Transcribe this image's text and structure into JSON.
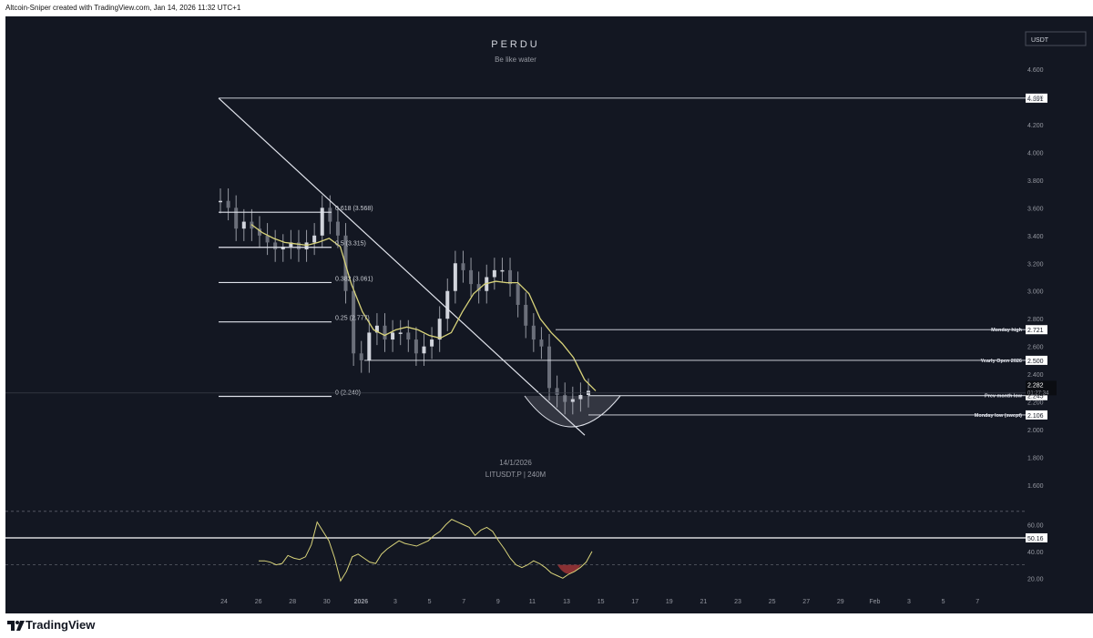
{
  "header": {
    "attribution": "Altcoin-Sniper created with TradingView.com, Jan 14, 2026 11:32 UTC+1"
  },
  "footer": {
    "brand": "TradingView"
  },
  "chart_data": {
    "type": "line",
    "title": "PERDU",
    "subtitle": "Be like water",
    "annotation_date": "14/1/2026",
    "symbol_label": "LITUSDT.P | 240M",
    "currency": "USDT",
    "price_axis": {
      "ticks": [
        "4.600",
        "4.400",
        "4.200",
        "4.000",
        "3.800",
        "3.600",
        "3.400",
        "3.200",
        "3.000",
        "2.800",
        "2.600",
        "2.400",
        "2.200",
        "2.000",
        "1.800",
        "1.600"
      ],
      "ylim": [
        1.6,
        4.6
      ]
    },
    "x_ticks": [
      "24",
      "26",
      "28",
      "30",
      "2026",
      "3",
      "5",
      "7",
      "9",
      "11",
      "13",
      "15",
      "17",
      "19",
      "21",
      "23",
      "25",
      "27",
      "29",
      "Feb",
      "3",
      "5",
      "7"
    ],
    "candles": [
      3.65,
      3.6,
      3.45,
      3.5,
      3.45,
      3.4,
      3.35,
      3.3,
      3.32,
      3.35,
      3.3,
      3.35,
      3.4,
      3.6,
      3.5,
      3.4,
      3.0,
      2.55,
      2.5,
      2.7,
      2.75,
      2.65,
      2.7,
      2.7,
      2.65,
      2.55,
      2.6,
      2.65,
      2.8,
      3.0,
      3.2,
      3.15,
      3.05,
      3.0,
      3.1,
      3.15,
      3.15,
      3.05,
      2.9,
      2.75,
      2.65,
      2.6,
      2.3,
      2.25,
      2.2,
      2.22,
      2.25,
      2.28
    ],
    "ma_series": {
      "name": "",
      "color": "#d8d37a",
      "values": [
        3.48,
        3.42,
        3.38,
        3.35,
        3.34,
        3.33,
        3.35,
        3.38,
        3.32,
        3.05,
        2.85,
        2.72,
        2.68,
        2.72,
        2.74,
        2.72,
        2.68,
        2.66,
        2.7,
        2.85,
        2.98,
        3.05,
        3.07,
        3.06,
        3.06,
        2.98,
        2.8,
        2.7,
        2.62,
        2.52,
        2.36,
        2.28
      ]
    },
    "fib_levels": [
      {
        "label": "0.618 (3.568)",
        "price": 3.568
      },
      {
        "label": "0.5 (3.315)",
        "price": 3.315
      },
      {
        "label": "0.382 (3.061)",
        "price": 3.061
      },
      {
        "label": "0.25 (2.777)",
        "price": 2.777
      },
      {
        "label": "0 (2.240)",
        "price": 2.24
      }
    ],
    "levels": [
      {
        "label": "",
        "price": 4.391,
        "tag": "4.391"
      },
      {
        "label": "Monday high",
        "price": 2.721,
        "tag": "2.721"
      },
      {
        "label": "Yearly Open 2026",
        "price": 2.5,
        "tag": "2.500"
      },
      {
        "label": "Prev month low",
        "price": 2.245,
        "tag": "2.245"
      },
      {
        "label": "Monday low (swept)",
        "price": 2.106,
        "tag": "2.106"
      }
    ],
    "last_price": {
      "value": "2.282",
      "countdown": "01:27:34"
    },
    "rsi": {
      "ticks": [
        "60.00",
        "40.00",
        "20.00"
      ],
      "ylim": [
        10,
        76
      ],
      "bands": [
        70,
        30
      ],
      "marker_line": 50.16,
      "marker_tag": "50.16",
      "values": [
        33,
        33,
        32,
        30,
        31,
        37,
        35,
        34,
        36,
        45,
        62,
        55,
        48,
        35,
        18,
        25,
        36,
        38,
        35,
        32,
        31,
        38,
        42,
        45,
        48,
        46,
        45,
        44,
        46,
        48,
        52,
        55,
        60,
        64,
        62,
        60,
        58,
        52,
        56,
        58,
        55,
        48,
        42,
        35,
        30,
        28,
        30,
        33,
        31,
        28,
        24,
        22,
        20,
        23,
        25,
        28,
        32,
        40
      ],
      "oversold_shade": "#b33a3a"
    }
  }
}
